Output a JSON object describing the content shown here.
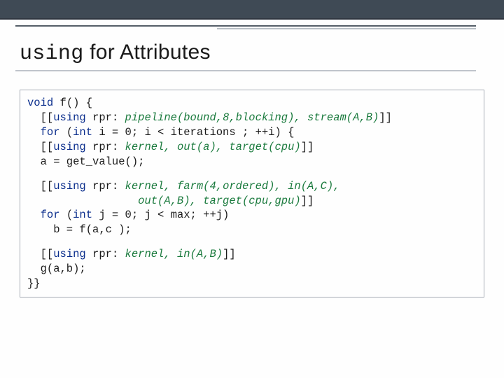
{
  "title": {
    "mono": "using",
    "rest": " for Attributes"
  },
  "code": {
    "block1": {
      "l1_kw": "void",
      "l1_rest": " f() {",
      "l2_pre": "  [[",
      "l2_using": "using",
      "l2_mid": " rpr: ",
      "l2_ital": "pipeline(bound,8,blocking), stream(A,B)",
      "l2_end": "]]",
      "l3_pre": "  ",
      "l3_for": "for",
      "l3_mid1": " (",
      "l3_int": "int",
      "l3_rest": " i = 0; i < iterations ; ++i) {",
      "l4_pre": "  [[",
      "l4_using": "using",
      "l4_mid": " rpr: ",
      "l4_ital": "kernel, out(a), target(cpu)",
      "l4_end": "]]",
      "l5": "  a = get_value();"
    },
    "block2": {
      "l1_pre": "  [[",
      "l1_using": "using",
      "l1_mid": " rpr: ",
      "l1_ital": "kernel, farm(4,ordered), in(A,C),",
      "l2_ital": "                 out(A,B), target(cpu,gpu)",
      "l2_end": "]]",
      "l3_pre": "  ",
      "l3_for": "for",
      "l3_mid1": " (",
      "l3_int": "int",
      "l3_rest": " j = 0; j < max; ++j)",
      "l4": "    b = f(a,c );"
    },
    "block3": {
      "l1_pre": "  [[",
      "l1_using": "using",
      "l1_mid": " rpr: ",
      "l1_ital": "kernel, in(A,B)",
      "l1_end": "]]",
      "l2": "  g(a,b);",
      "l3": "}}"
    }
  }
}
